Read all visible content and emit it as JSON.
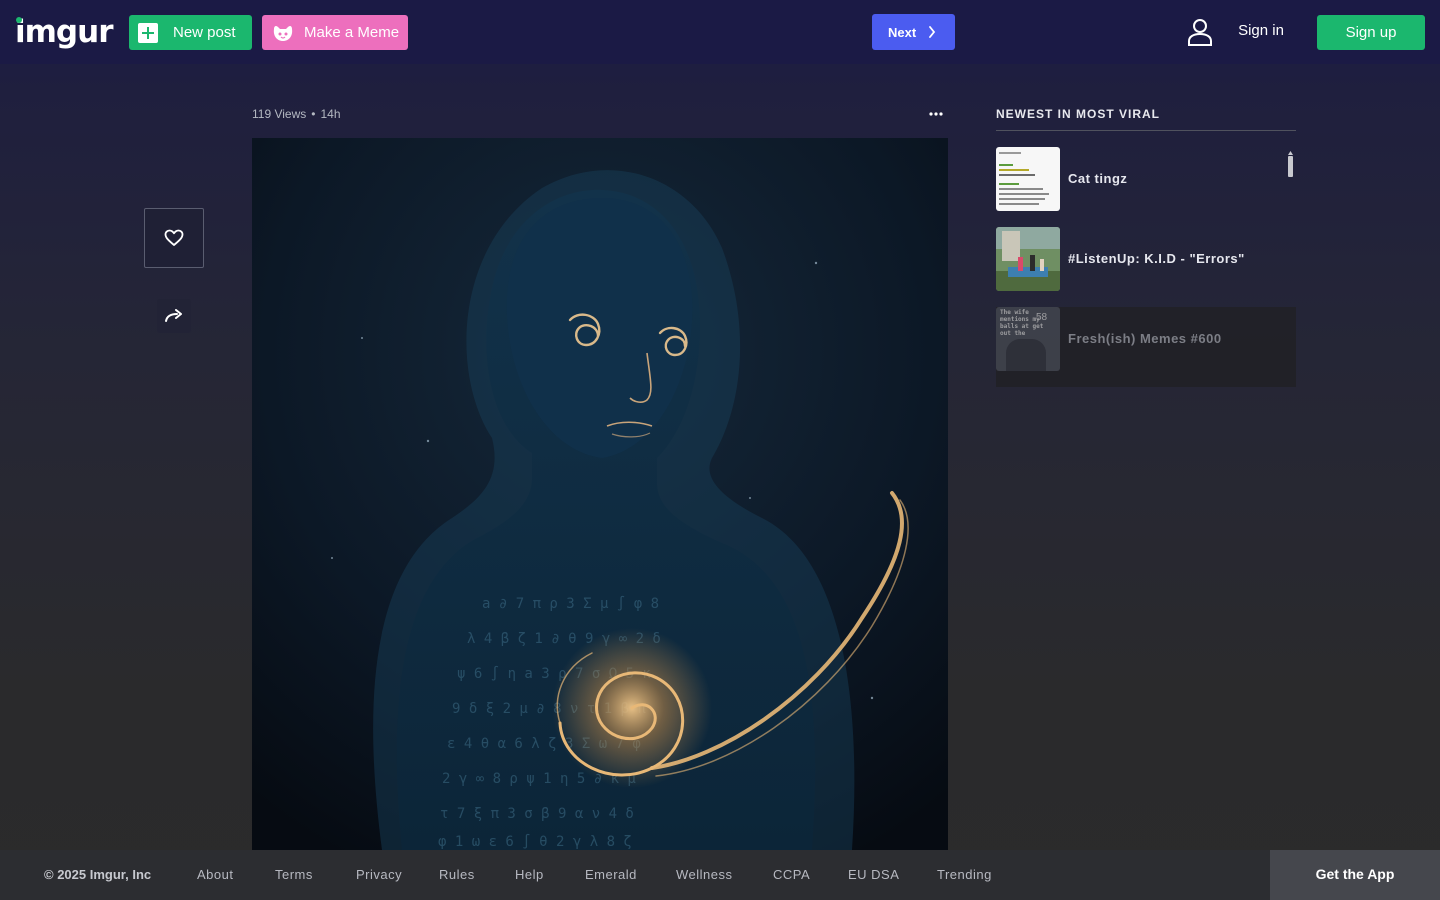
{
  "header": {
    "logo_text": "imgur",
    "new_post_label": "New post",
    "meme_label": "Make a Meme",
    "next_label": "Next",
    "signin_label": "Sign in",
    "signup_label": "Sign up",
    "accent_green": "#1bb76e",
    "accent_pink": "#ed6fbd",
    "accent_blue": "#4b5cf0"
  },
  "post": {
    "views": "119 Views",
    "separator": "•",
    "age": "14h"
  },
  "sidebar": {
    "title": "NEWEST IN MOST VIRAL",
    "items": [
      {
        "title": "Cat tingz"
      },
      {
        "title": "#ListenUp: K.I.D - \"Errors\""
      },
      {
        "title": "Fresh(ish) Memes #600",
        "thumb_badge": "58",
        "thumb_caption": "The wife mentions my balls at get out the"
      }
    ]
  },
  "footer": {
    "copyright": "© 2025 Imgur, Inc",
    "links": [
      "About",
      "Terms",
      "Privacy",
      "Rules",
      "Help",
      "Emerald",
      "Wellness",
      "CCPA",
      "EU DSA",
      "Trending"
    ],
    "get_app": "Get the App"
  }
}
